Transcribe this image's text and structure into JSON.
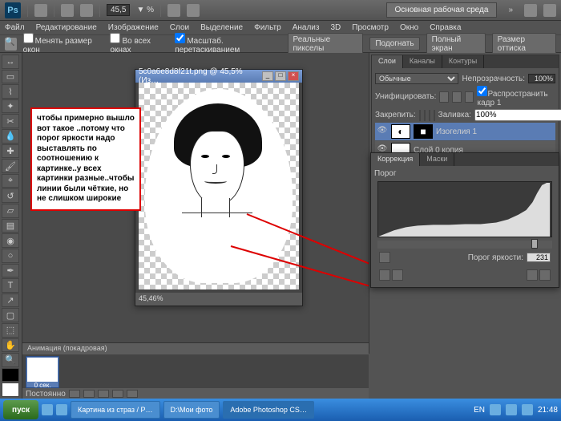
{
  "topbar": {
    "zoom": "45,5",
    "workspace": "Основная рабочая среда"
  },
  "menu": [
    "Файл",
    "Редактирование",
    "Изображение",
    "Слои",
    "Выделение",
    "Фильтр",
    "Анализ",
    "3D",
    "Просмотр",
    "Окно",
    "Справка"
  ],
  "optbar": {
    "resize": "Менять размер окон",
    "allwin": "Во всех окнах",
    "dragzoom": "Масштаб. перетаскиванием",
    "realpx": "Реальные пикселы",
    "fit": "Подогнать",
    "full": "Полный экран",
    "print": "Размер оттиска"
  },
  "doc": {
    "title": "5c0a6e8d8f21t.png @ 45,5% (Из…",
    "status": "45,46%"
  },
  "callout": "чтобы примерно вышло вот такое ..потому что  порог яркости надо выставлять по соотношению к картинке..у всех картинки разные..чтобы линии были чёткие, но не слишком широкие",
  "layers_panel": {
    "tabs": [
      "Слои",
      "Каналы",
      "Контуры"
    ],
    "mode": "Обычные",
    "opacity_label": "Непрозрачность:",
    "opacity": "100%",
    "unify_label": "Унифицировать:",
    "propagate": "Распространить кадр 1",
    "lock_label": "Закрепить:",
    "fill_label": "Заливка:",
    "fill": "100%",
    "layers": [
      {
        "name": "Изогелия 1"
      },
      {
        "name": "Слой 0 копия"
      }
    ]
  },
  "threshold": {
    "tabs": [
      "Коррекция",
      "Маски"
    ],
    "title": "Порог",
    "label": "Порог яркости:",
    "value": "231"
  },
  "animation": {
    "title": "Анимация (покадровая)",
    "frame": "0 сек.",
    "repeat": "Постоянно"
  },
  "taskbar": {
    "start": "пуск",
    "items": [
      "Картина из страз / Р…",
      "D:\\Мои фото",
      "Adobe Photoshop CS…"
    ],
    "lang": "EN",
    "time": "21:48"
  }
}
